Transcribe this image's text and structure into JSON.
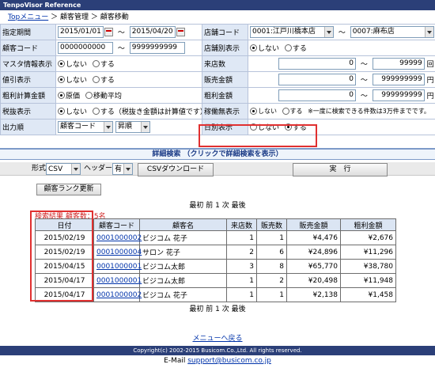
{
  "app": {
    "title": "TenpoVisor Reference"
  },
  "breadcrumb": {
    "top": "Topメニュー",
    "sep1": "＞",
    "section": "顧客管理",
    "sep2": "＞",
    "page": "顧客移動"
  },
  "conditions": {
    "period": {
      "label": "指定期間",
      "from": "2015/01/01",
      "sep": "～",
      "to": "2015/04/20"
    },
    "store_code": {
      "label": "店舗コード",
      "from": "0001:江戸川橋本店",
      "sep": "～",
      "to": "0007:麻布店"
    },
    "customer_code": {
      "label": "顧客コード",
      "from": "0000000000",
      "sep": "～",
      "to": "9999999999"
    },
    "store_alias": {
      "label": "店舗別表示",
      "off": "しない",
      "on": "する"
    },
    "master_info": {
      "label": "マスタ情報表示",
      "off": "しない",
      "on": "する"
    },
    "visits": {
      "label": "来店数",
      "from": "0",
      "sep": "～",
      "to": "99999",
      "unit": "回"
    },
    "discount": {
      "label": "値引表示",
      "off": "しない",
      "on": "する"
    },
    "sales_amount": {
      "label": "販売金額",
      "from": "0",
      "sep": "～",
      "to": "999999999",
      "unit": "円"
    },
    "gross_profit_calc": {
      "label": "粗利計算金額",
      "opt1": "原価",
      "opt2": "移動平均"
    },
    "gross_profit": {
      "label": "粗利金額",
      "from": "0",
      "sep": "～",
      "to": "999999999",
      "unit": "円"
    },
    "tax": {
      "label": "税抜表示",
      "off": "しない",
      "on": "する（税抜き金額は計算値です）"
    },
    "dormant": {
      "label": "稼働無表示",
      "off": "しない",
      "on": "する",
      "note": "※一度に検索できる件数は3万件までです。"
    },
    "output_order": {
      "label": "出力順",
      "field": "顧客コード",
      "order": "昇順"
    },
    "daily": {
      "label": "日別表示",
      "off": "しない",
      "on": "する"
    }
  },
  "detail_search": {
    "label": "詳細検索 （クリックで詳細検索を表示）"
  },
  "controls": {
    "format_label": "形式",
    "format_value": "CSV",
    "header_label": "ヘッダー",
    "header_value": "有",
    "download_button": "CSVダウンロード",
    "execute_button": "実　行"
  },
  "rank_button": "顧客ランク更新",
  "pager": {
    "first": "最初",
    "prev": "前",
    "page": "1",
    "next": "次",
    "last": "最後"
  },
  "summary": {
    "text": "検索結果 顧客数：",
    "count": "5",
    "unit": "名"
  },
  "table": {
    "headers": [
      "日付",
      "顧客コード",
      "顧客名",
      "来店数",
      "販売数",
      "販売金額",
      "粗利金額"
    ],
    "rows": [
      [
        "2015/02/19",
        "0001000002",
        "ビジコム 花子",
        "1",
        "1",
        "¥4,476",
        "¥2,676"
      ],
      [
        "2015/02/19",
        "0001000004",
        "サロン 花子",
        "2",
        "6",
        "¥24,896",
        "¥11,296"
      ],
      [
        "2015/04/15",
        "0001000001",
        "ビジコム太郎",
        "3",
        "8",
        "¥65,770",
        "¥38,780"
      ],
      [
        "2015/04/17",
        "0001000001",
        "ビジコム太郎",
        "1",
        "2",
        "¥20,498",
        "¥11,948"
      ],
      [
        "2015/04/17",
        "0001000002",
        "ビジコム 花子",
        "1",
        "1",
        "¥2,138",
        "¥1,458"
      ]
    ]
  },
  "back_link": "メニューへ戻る",
  "footer": {
    "copyright": "Copyright(c) 2002-2015 Busicom.Co.,Ltd. All rights reserved.",
    "email_label": "E-Mail",
    "email": "support@busicom.co.jp"
  },
  "colors": {
    "header_bg": "#2b3f78",
    "label_bg": "#dfe8f5",
    "highlight": "#e03030",
    "link": "#0033aa"
  }
}
